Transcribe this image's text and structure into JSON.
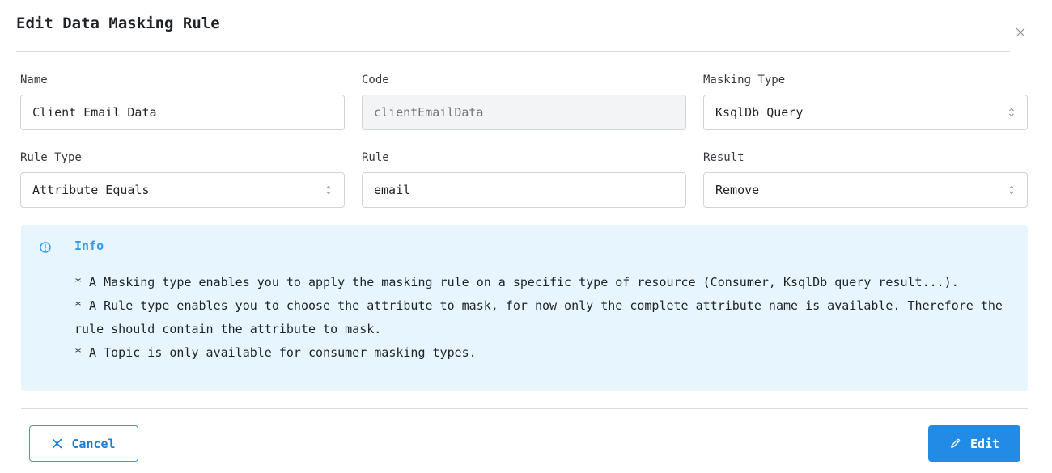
{
  "modal": {
    "title": "Edit Data Masking Rule",
    "close_icon": "close-icon"
  },
  "form": {
    "name": {
      "label": "Name",
      "value": "Client Email Data"
    },
    "code": {
      "label": "Code",
      "placeholder": "clientEmailData"
    },
    "masking_type": {
      "label": "Masking Type",
      "value": "KsqlDb Query"
    },
    "rule_type": {
      "label": "Rule Type",
      "value": "Attribute Equals"
    },
    "rule": {
      "label": "Rule",
      "value": "email"
    },
    "result": {
      "label": "Result",
      "value": "Remove"
    }
  },
  "info": {
    "icon": "info-circle-icon",
    "title": "Info",
    "lines": [
      "* A Masking type enables you to apply the masking rule on a specific type of resource (Consumer, KsqlDb query result...).",
      "* A Rule type enables you to choose the attribute to mask, for now only the complete attribute name is available. Therefore the rule should contain the attribute to mask.",
      "* A Topic is only available for consumer masking types."
    ]
  },
  "actions": {
    "cancel_label": "Cancel",
    "cancel_icon": "x-icon",
    "edit_label": "Edit",
    "edit_icon": "pencil-icon"
  },
  "colors": {
    "accent": "#228be6",
    "info_background": "#e7f5ff",
    "info_title": "#339af0"
  }
}
